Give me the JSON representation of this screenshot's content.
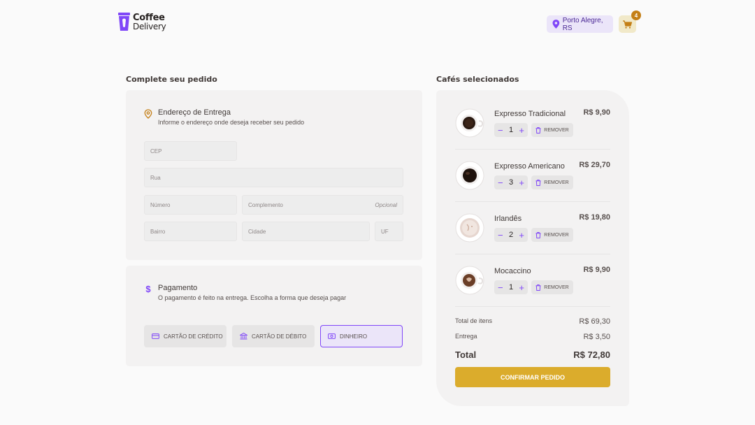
{
  "header": {
    "logo": {
      "line1": "Coffee",
      "line2": "Delivery"
    },
    "location": "Porto Alegre, RS",
    "cart_count": "4"
  },
  "checkout": {
    "title": "Complete seu pedido",
    "address": {
      "title": "Endereço de Entrega",
      "subtitle": "Informe o endereço onde deseja receber seu pedido",
      "fields": {
        "cep": "CEP",
        "rua": "Rua",
        "numero": "Número",
        "complemento": "Complemento",
        "complemento_hint": "Opcional",
        "bairro": "Bairro",
        "cidade": "Cidade",
        "uf": "UF"
      }
    },
    "payment": {
      "title": "Pagamento",
      "subtitle": "O pagamento é feito na entrega. Escolha a forma que deseja pagar",
      "options": [
        "CARTÃO DE CRÉDITO",
        "CARTÃO DE DÉBITO",
        "DINHEIRO"
      ],
      "selected": "DINHEIRO"
    }
  },
  "cart": {
    "title": "Cafés selecionados",
    "remove_label": "REMOVER",
    "items": [
      {
        "name": "Expresso Tradicional",
        "price": "R$ 9,90",
        "qty": "1"
      },
      {
        "name": "Expresso Americano",
        "price": "R$ 29,70",
        "qty": "3"
      },
      {
        "name": "Irlandês",
        "price": "R$ 19,80",
        "qty": "2"
      },
      {
        "name": "Mocaccino",
        "price": "R$ 9,90",
        "qty": "1"
      }
    ],
    "summary": {
      "items_label": "Total de itens",
      "items_value": "R$ 69,30",
      "delivery_label": "Entrega",
      "delivery_value": "R$ 3,50",
      "total_label": "Total",
      "total_value": "R$ 72,80"
    },
    "confirm_label": "CONFIRMAR PEDIDO"
  },
  "colors": {
    "purple": "#8047f8",
    "yellow": "#dbac2c",
    "yellow_dark": "#c47f17",
    "card_bg": "#f3f2f2"
  }
}
